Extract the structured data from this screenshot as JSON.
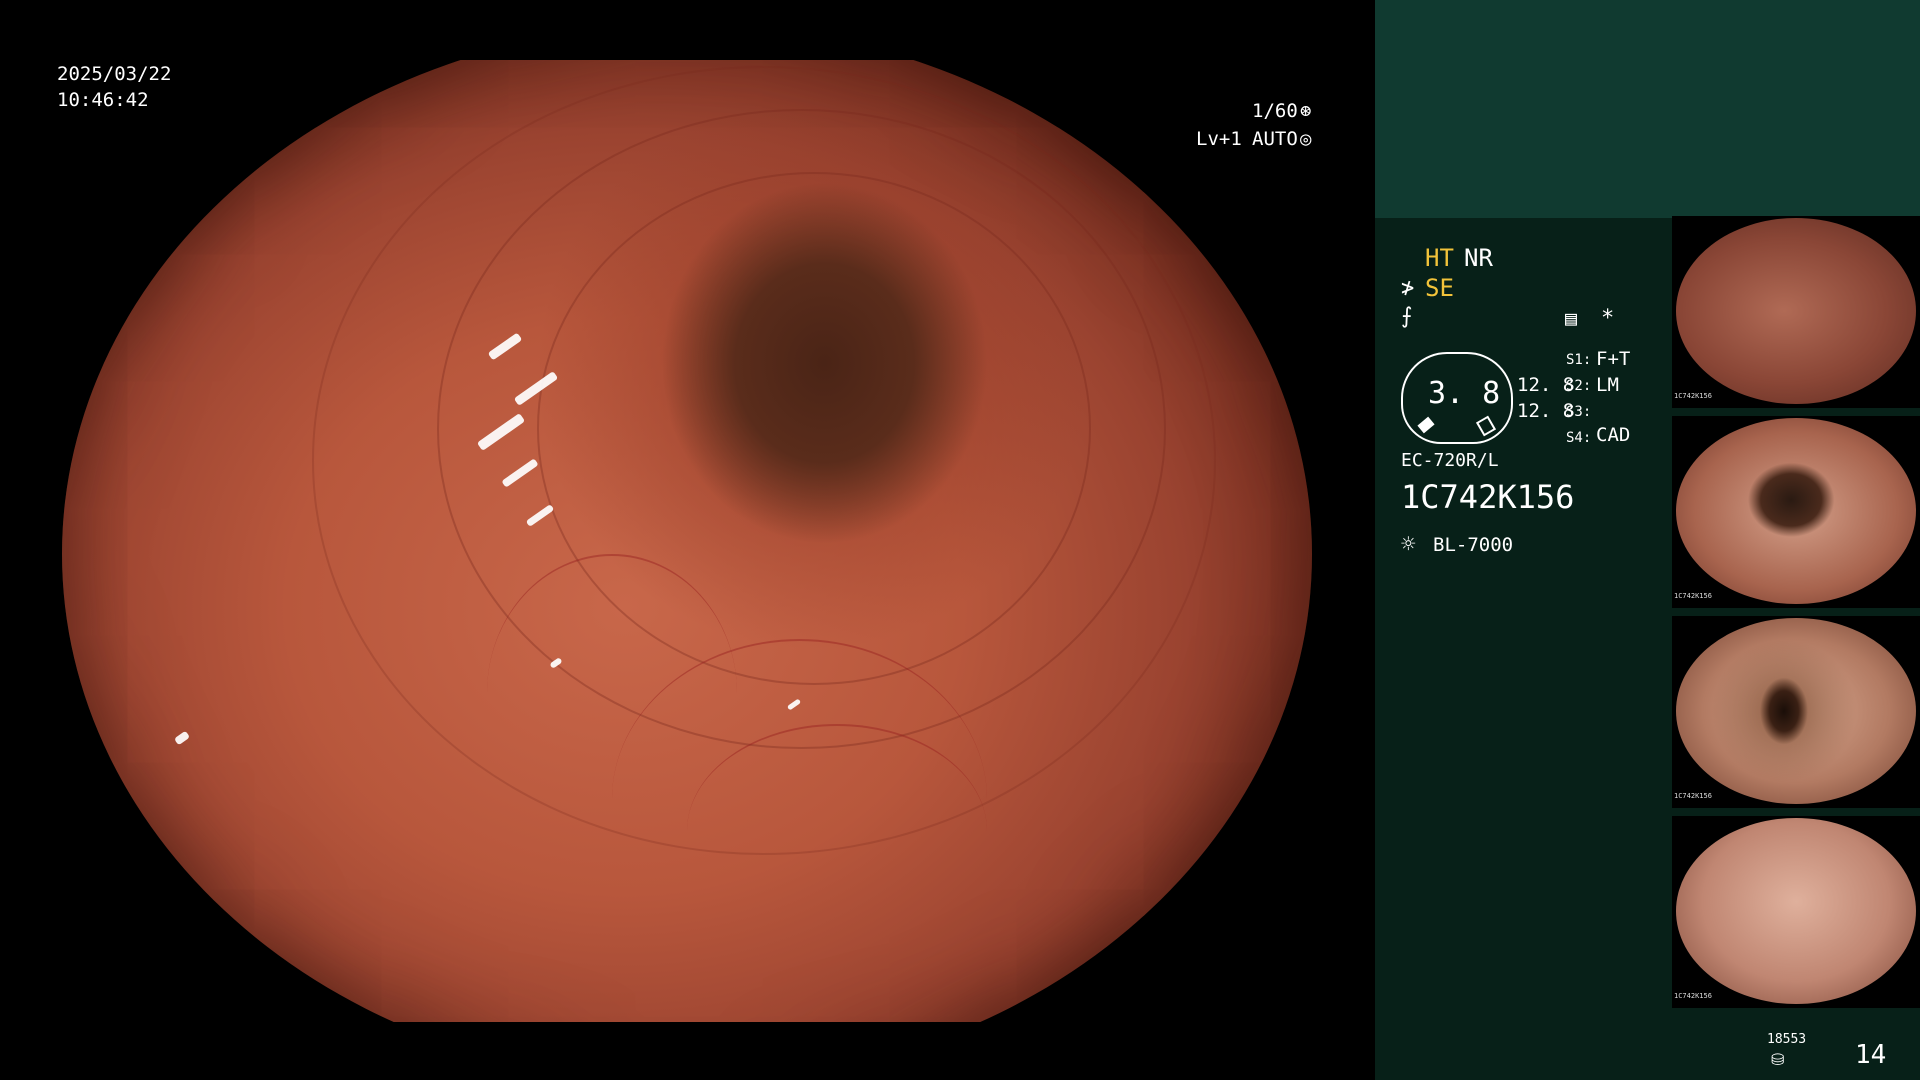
{
  "overlay": {
    "date": "2025/03/22",
    "time": "10:46:42",
    "shutter": "1/60",
    "level": "Lv+1",
    "iris_mode": "AUTO"
  },
  "panel": {
    "ht_label": "HT",
    "nr_label": "NR",
    "se_label": "SE",
    "star_label": "*",
    "gauge_value": "3. 8",
    "val1": "12. 8",
    "val2": "12. 8",
    "s1": "S1:",
    "s1_value": "F+T",
    "s2": "S2:",
    "s2_value": "LM",
    "s3": "S3:",
    "s3_value": "",
    "s4": "S4:",
    "s4_value": "CAD",
    "scope_model": "EC-720R/L",
    "scope_serial": "1C742K156",
    "light_source": "BL-7000",
    "storage_count": "18553",
    "image_count": "14"
  },
  "thumbnails": [
    {
      "label": "1C742K156"
    },
    {
      "label": "1C742K156"
    },
    {
      "label": "1C742K156"
    },
    {
      "label": "1C742K156"
    }
  ],
  "colors": {
    "panel_bg": "#072018",
    "panel_top": "#103a30",
    "accent_yellow": "#f2c33a",
    "mucosa": "#c8674a"
  }
}
